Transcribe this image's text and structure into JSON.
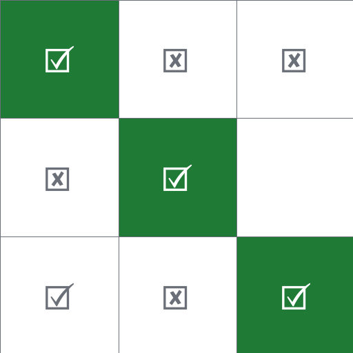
{
  "colors": {
    "win_background": "#1f7a35",
    "cell_background": "#ffffff",
    "grid_line": "#6b7078",
    "mark_gray": "#6b7078",
    "mark_white": "#ffffff"
  },
  "board": {
    "rows": 3,
    "cols": 3,
    "cells": [
      {
        "mark": "check",
        "icon": "checked-box-icon",
        "highlighted": true
      },
      {
        "mark": "cross",
        "icon": "crossed-box-icon",
        "highlighted": false
      },
      {
        "mark": "cross",
        "icon": "crossed-box-icon",
        "highlighted": false
      },
      {
        "mark": "cross",
        "icon": "crossed-box-icon",
        "highlighted": false
      },
      {
        "mark": "check",
        "icon": "checked-box-icon",
        "highlighted": true
      },
      {
        "mark": "empty",
        "icon": "",
        "highlighted": false
      },
      {
        "mark": "check",
        "icon": "checked-box-icon",
        "highlighted": false
      },
      {
        "mark": "cross",
        "icon": "crossed-box-icon",
        "highlighted": false
      },
      {
        "mark": "check",
        "icon": "checked-box-icon",
        "highlighted": true
      }
    ]
  }
}
